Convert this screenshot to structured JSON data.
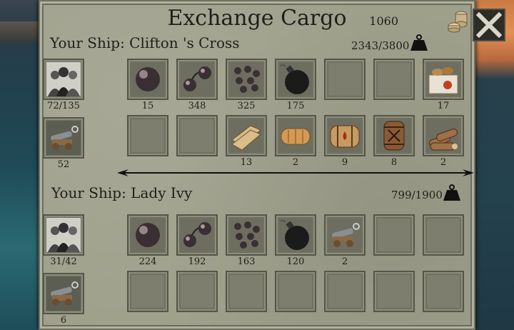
{
  "window": {
    "title": "Exchange Cargo",
    "gold": "1060"
  },
  "ship1": {
    "name": "Your Ship: Clifton 's Cross",
    "capacity": "2343/3800",
    "crew": "72/135",
    "cannons": "52",
    "row1": [
      {
        "icon": "cannonball-icon",
        "qty": "15"
      },
      {
        "icon": "chain-shot-icon",
        "qty": "348"
      },
      {
        "icon": "grapeshot-icon",
        "qty": "325"
      },
      {
        "icon": "bomb-icon",
        "qty": "175"
      },
      {
        "icon": "",
        "qty": ""
      },
      {
        "icon": "",
        "qty": ""
      },
      {
        "icon": "crate-icon",
        "qty": "17"
      }
    ],
    "row2": [
      {
        "icon": "",
        "qty": ""
      },
      {
        "icon": "",
        "qty": ""
      },
      {
        "icon": "planks-icon",
        "qty": "13"
      },
      {
        "icon": "bread-icon",
        "qty": "2"
      },
      {
        "icon": "rum-barrel-icon",
        "qty": "9"
      },
      {
        "icon": "gunpowder-barrel-icon",
        "qty": "8"
      },
      {
        "icon": "firewood-icon",
        "qty": "2"
      }
    ]
  },
  "ship2": {
    "name": "Your Ship: Lady Ivy",
    "capacity": "799/1900",
    "crew": "31/42",
    "cannons": "6",
    "row1": [
      {
        "icon": "cannonball-icon",
        "qty": "224"
      },
      {
        "icon": "chain-shot-icon",
        "qty": "192"
      },
      {
        "icon": "grapeshot-icon",
        "qty": "163"
      },
      {
        "icon": "bomb-icon",
        "qty": "120"
      },
      {
        "icon": "cannon-icon",
        "qty": "2"
      },
      {
        "icon": "",
        "qty": ""
      },
      {
        "icon": "",
        "qty": ""
      }
    ],
    "row2": [
      {
        "icon": "",
        "qty": ""
      },
      {
        "icon": "",
        "qty": ""
      },
      {
        "icon": "",
        "qty": ""
      },
      {
        "icon": "",
        "qty": ""
      },
      {
        "icon": "",
        "qty": ""
      },
      {
        "icon": "",
        "qty": ""
      },
      {
        "icon": "",
        "qty": ""
      }
    ]
  }
}
